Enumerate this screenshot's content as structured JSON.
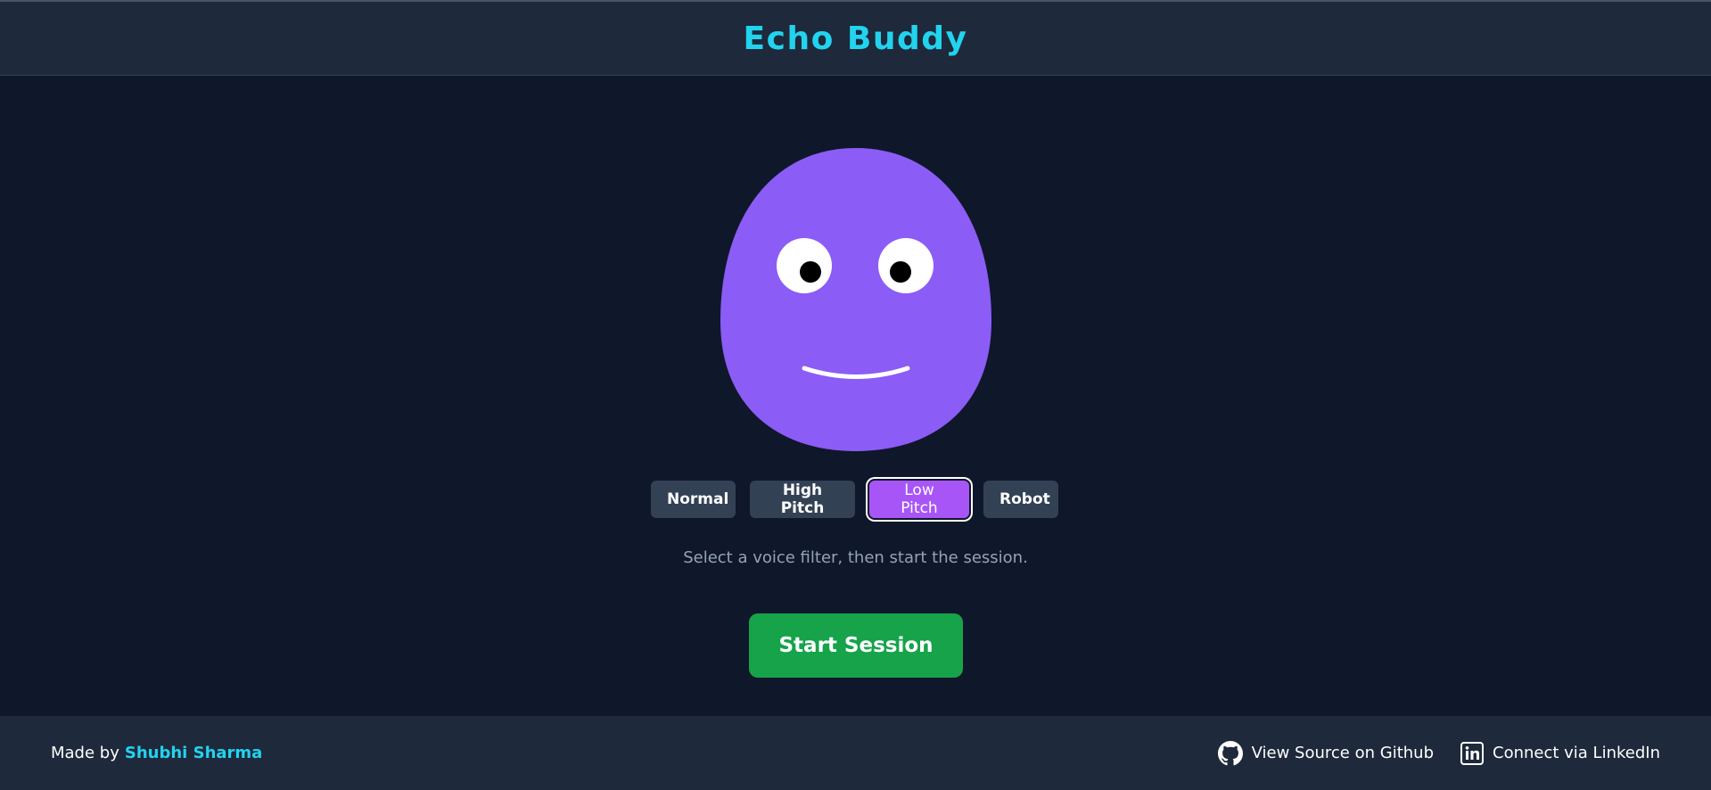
{
  "header": {
    "title": "Echo Buddy"
  },
  "buddy": {
    "body_color": "#8b5cf6",
    "eye_color": "#ffffff",
    "pupil_color": "#000000",
    "mouth_color": "#ffffff"
  },
  "filters": {
    "items": [
      {
        "label": "Normal",
        "active": false
      },
      {
        "label": "High Pitch",
        "active": false
      },
      {
        "label": "Low Pitch",
        "active": true
      },
      {
        "label": "Robot",
        "active": false
      }
    ],
    "active_color": "#a855f7",
    "inactive_color": "#334155"
  },
  "hint": "Select a voice filter, then start the session.",
  "start_button": {
    "label": "Start Session",
    "color": "#16a34a"
  },
  "footer": {
    "made_by": "Made by",
    "author": "Shubhi Sharma",
    "github_label": "View Source on Github",
    "github_icon": "github-icon",
    "linkedin_label": "Connect via LinkedIn",
    "linkedin_icon": "linkedin-icon"
  },
  "colors": {
    "background": "#0f172a",
    "header_bg": "#1e293b",
    "accent": "#22d3ee"
  }
}
